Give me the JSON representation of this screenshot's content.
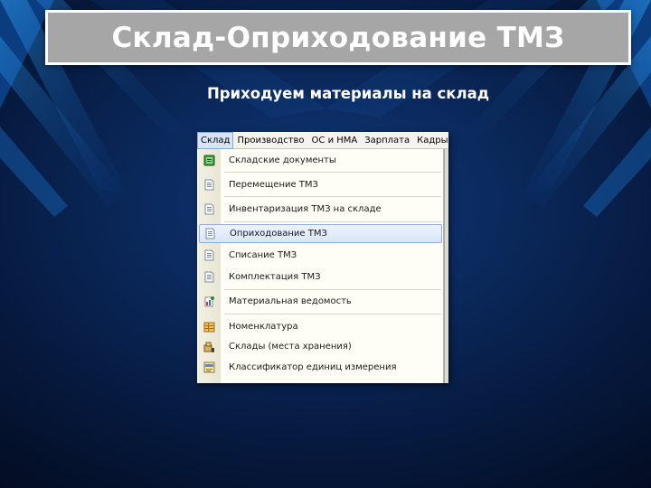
{
  "slide": {
    "title": "Склад-Оприходование ТМЗ",
    "subtitle": "Приходуем материалы на склад"
  },
  "menubar": {
    "items": [
      "Склад",
      "Производство",
      "ОС и НМА",
      "Зарплата",
      "Кадры"
    ],
    "active_item": "Склад"
  },
  "dropdown": {
    "items": [
      {
        "label": "Складские документы",
        "icon": "green-folder-icon"
      },
      {
        "label": "Перемещение ТМЗ",
        "icon": "document-icon"
      },
      {
        "label": "Инвентаризация ТМЗ на складе",
        "icon": "document-icon"
      },
      {
        "label": "Оприходование ТМЗ",
        "icon": "document-icon",
        "selected": true
      },
      {
        "label": "Списание ТМЗ",
        "icon": "document-icon"
      },
      {
        "label": "Комплектация ТМЗ",
        "icon": "document-icon"
      },
      {
        "label": "Материальная ведомость",
        "icon": "report-icon"
      },
      {
        "label": "Номенклатура",
        "icon": "catalog-icon"
      },
      {
        "label": "Склады (места хранения)",
        "icon": "warehouse-icon"
      },
      {
        "label": "Классификатор единиц измерения",
        "icon": "classifier-icon"
      }
    ]
  },
  "colors": {
    "title_box": "#a6a6a6",
    "background_dark": "#030a1c",
    "background_blue": "#0b2a5e",
    "selection": "#d9e5f7"
  }
}
